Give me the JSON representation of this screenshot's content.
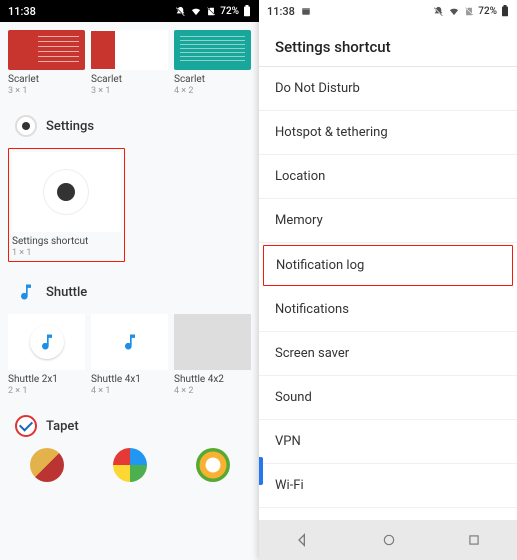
{
  "left": {
    "status": {
      "time": "11:38",
      "battery_pct": "72%"
    },
    "scarlet": {
      "items": [
        {
          "label": "Scarlet",
          "size": "3 × 1"
        },
        {
          "label": "Scarlet",
          "size": "3 × 1"
        },
        {
          "label": "Scarlet",
          "size": "4 × 2"
        }
      ]
    },
    "settings": {
      "title": "Settings",
      "widget": {
        "label": "Settings shortcut",
        "size": "1 × 1"
      }
    },
    "shuttle": {
      "title": "Shuttle",
      "items": [
        {
          "label": "Shuttle 2x1",
          "size": "2 × 1"
        },
        {
          "label": "Shuttle 4x1",
          "size": "4 × 1"
        },
        {
          "label": "Shuttle 4x2",
          "size": "4 × 2"
        }
      ]
    },
    "tapet": {
      "title": "Tapet"
    }
  },
  "right": {
    "status": {
      "time": "11:38",
      "battery_pct": "72%"
    },
    "header": "Settings shortcut",
    "items": [
      "Do Not Disturb",
      "Hotspot & tethering",
      "Location",
      "Memory",
      "Notification log",
      "Notifications",
      "Screen saver",
      "Sound",
      "VPN",
      "Wi-Fi"
    ],
    "highlight_index": 4
  }
}
